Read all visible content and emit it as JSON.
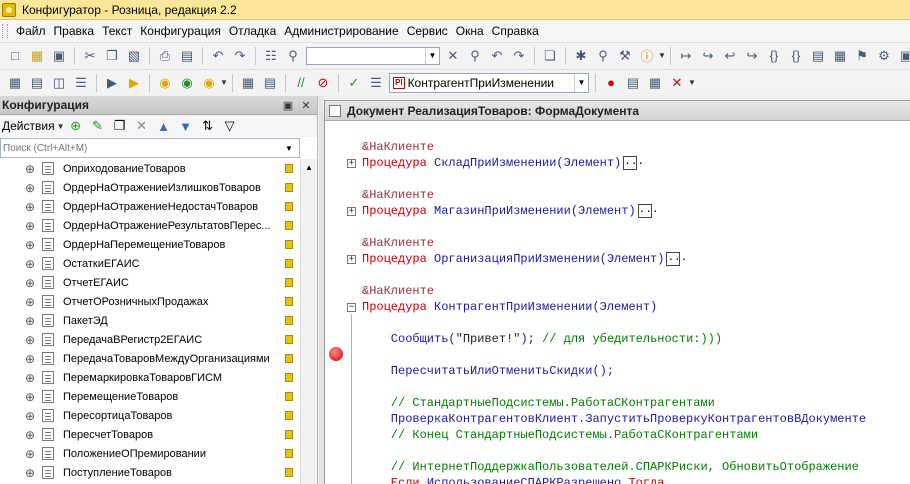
{
  "window": {
    "title": "Конфигуратор - Розница, редакция 2.2"
  },
  "menu": [
    "Файл",
    "Правка",
    "Текст",
    "Конфигурация",
    "Отладка",
    "Администрирование",
    "Сервис",
    "Окна",
    "Справка"
  ],
  "toolbar": {
    "search_value": "",
    "procedure_combo": {
      "badge": "Pl",
      "value": "КонтрагентПриИзменении"
    }
  },
  "left_panel": {
    "title": "Конфигурация",
    "actions_label": "Действия",
    "search_placeholder": "Поиск (Ctrl+Alt+M)",
    "items": [
      "ОприходованиеТоваров",
      "ОрдерНаОтражениеИзлишковТоваров",
      "ОрдерНаОтражениеНедостачТоваров",
      "ОрдерНаОтражениеРезультатовПерес...",
      "ОрдерНаПеремещениеТоваров",
      "ОстаткиЕГАИС",
      "ОтчетЕГАИС",
      "ОтчетОРозничныхПродажах",
      "ПакетЭД",
      "ПередачаВРегистр2ЕГАИС",
      "ПередачаТоваровМеждуОрганизациями",
      "ПеремаркировкаТоваровГИСМ",
      "ПеремещениеТоваров",
      "ПересортицаТоваров",
      "ПересчетТоваров",
      "ПоложениеОПремировании",
      "ПоступлениеТоваров"
    ]
  },
  "editor": {
    "title": "Документ РеализацияТоваров: ФормаДокумента",
    "lines": [
      {
        "parts": [
          [
            "pre",
            "&НаКлиенте"
          ]
        ]
      },
      {
        "parts": [
          [
            "kw",
            "Процедура "
          ],
          [
            "id",
            "СкладПриИзменении(Элемент)"
          ]
        ],
        "box": "..."
      },
      {
        "parts": [
          [
            "pre",
            "&НаКлиенте"
          ]
        ]
      },
      {
        "parts": [
          [
            "kw",
            "Процедура "
          ],
          [
            "id",
            "МагазинПриИзменении(Элемент)"
          ]
        ],
        "box": "..."
      },
      {
        "parts": [
          [
            "pre",
            "&НаКлиенте"
          ]
        ]
      },
      {
        "parts": [
          [
            "kw",
            "Процедура "
          ],
          [
            "id",
            "ОрганизацияПриИзменении(Элемент)"
          ]
        ],
        "box": "..."
      },
      {
        "parts": [
          [
            "pre",
            "&НаКлиенте"
          ]
        ]
      },
      {
        "parts": [
          [
            "kw",
            "Процедура "
          ],
          [
            "id",
            "КонтрагентПриИзменении(Элемент)"
          ]
        ]
      },
      {
        "parts": [
          [
            "id",
            "    Сообщить("
          ],
          [
            "str",
            "\"Привет!\""
          ],
          [
            "id",
            "); "
          ],
          [
            "cmt",
            "// для убедительности:)))"
          ]
        ]
      },
      {
        "parts": [
          [
            "id",
            "    ПересчитатьИлиОтменитьСкидки();"
          ]
        ]
      },
      {
        "parts": [
          [
            "cmt",
            "    // СтандартныеПодсистемы.РаботаСКонтрагентами"
          ]
        ]
      },
      {
        "parts": [
          [
            "id",
            "    ПроверкаКонтрагентовКлиент.ЗапуститьПроверкуКонтрагентовВДокументе"
          ]
        ]
      },
      {
        "parts": [
          [
            "cmt",
            "    // Конец СтандартныеПодсистемы.РаботаСКонтрагентами"
          ]
        ]
      },
      {
        "parts": [
          [
            "cmt",
            "    // ИнтернетПоддержкаПользователей.СПАРКРиски, ОбновитьОтображение"
          ]
        ]
      },
      {
        "parts": [
          [
            "kw",
            "    Если "
          ],
          [
            "id",
            "ИспользованиеСПАРКРазрешено "
          ],
          [
            "kw",
            "Тогда"
          ]
        ]
      }
    ]
  }
}
